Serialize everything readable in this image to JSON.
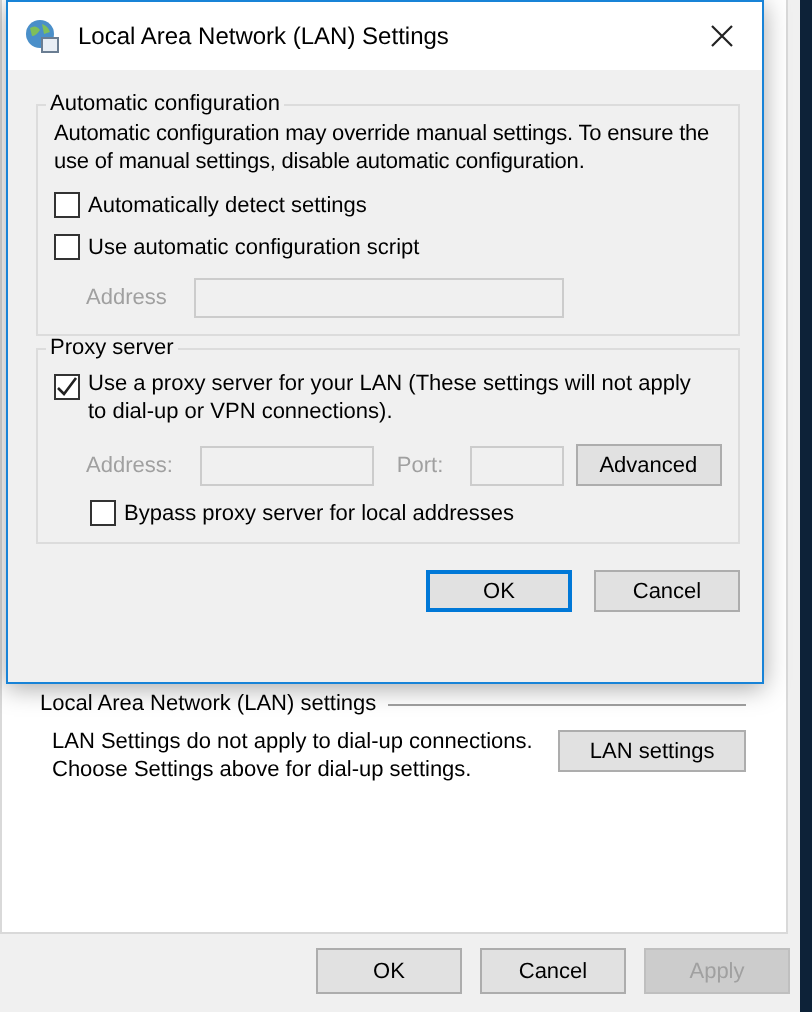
{
  "background_window": {
    "lan_group": {
      "title": "Local Area Network (LAN) settings",
      "description": "LAN Settings do not apply to dial-up connections. Choose Settings above for dial-up settings.",
      "button": "LAN settings"
    },
    "buttons": [
      {
        "label": "OK",
        "disabled": false
      },
      {
        "label": "Cancel",
        "disabled": false
      },
      {
        "label": "Apply",
        "disabled": true
      }
    ]
  },
  "dialog": {
    "title": "Local Area Network (LAN) Settings",
    "automatic_configuration": {
      "title": "Automatic configuration",
      "description": "Automatic configuration may override manual settings.  To ensure the use of manual settings, disable automatic configuration.",
      "checkboxes": [
        {
          "label": "Automatically detect settings",
          "checked": false
        },
        {
          "label": "Use automatic configuration script",
          "checked": false
        }
      ],
      "address": {
        "label": "Address",
        "disabled": true
      }
    },
    "proxy_server": {
      "title": "Proxy server",
      "use_proxy": {
        "label": "Use a proxy server for your LAN (These settings will not apply to dial-up or VPN connections).",
        "checked": true
      },
      "address": {
        "label": "Address:",
        "disabled": true
      },
      "port": {
        "label": "Port:",
        "disabled": true
      },
      "advanced_button": "Advanced",
      "bypass": {
        "label": "Bypass proxy server for local addresses",
        "checked": false
      }
    },
    "buttons": [
      {
        "label": "OK",
        "default": true
      },
      {
        "label": "Cancel",
        "default": false
      }
    ]
  }
}
